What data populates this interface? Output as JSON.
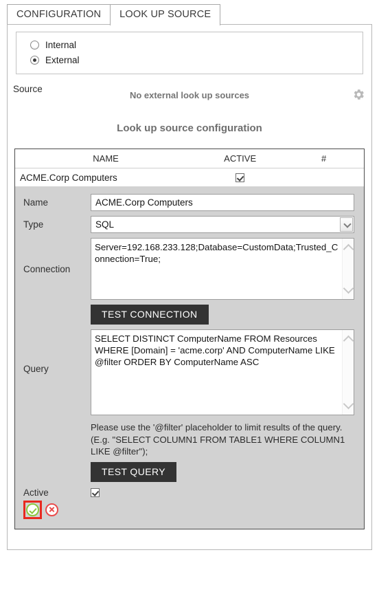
{
  "tabs": [
    {
      "label": "CONFIGURATION",
      "active": false
    },
    {
      "label": "LOOK UP SOURCE",
      "active": true
    }
  ],
  "source_mode": {
    "options": [
      {
        "label": "Internal",
        "selected": false
      },
      {
        "label": "External",
        "selected": true
      }
    ]
  },
  "source_row": {
    "label": "Source",
    "empty_message": "No external look up sources",
    "gear_icon": "gear-icon"
  },
  "section": {
    "title": "Look up source configuration"
  },
  "table": {
    "headers": [
      "NAME",
      "ACTIVE",
      "#"
    ],
    "rows": [
      {
        "name": "ACME.Corp Computers",
        "active": true,
        "hash": ""
      }
    ]
  },
  "editor": {
    "name_label": "Name",
    "name_value": "ACME.Corp Computers",
    "type_label": "Type",
    "type_value": "SQL",
    "type_options": [
      "SQL"
    ],
    "connection_label": "Connection",
    "connection_value": "Server=192.168.233.128;Database=CustomData;Trusted_Connection=True;",
    "test_connection_label": "TEST CONNECTION",
    "query_label": "Query",
    "query_value": "SELECT DISTINCT ComputerName FROM Resources WHERE [Domain] = 'acme.corp' AND ComputerName LIKE @filter ORDER BY ComputerName ASC",
    "hint": "Please use the '@filter' placeholder to limit results of the query. (E.g. \"SELECT COLUMN1 FROM TABLE1 WHERE COLUMN1 LIKE @filter\");",
    "test_query_label": "TEST QUERY",
    "active_label": "Active",
    "active_checked": true,
    "accept_icon": "accept-check-icon",
    "cancel_icon": "cancel-x-icon"
  },
  "colors": {
    "accent_dark": "#333333",
    "highlight_red": "#e8291f",
    "accept_green": "#8cc63e",
    "cancel_red": "#e94b4b",
    "editor_bg": "#d2d2d2"
  }
}
